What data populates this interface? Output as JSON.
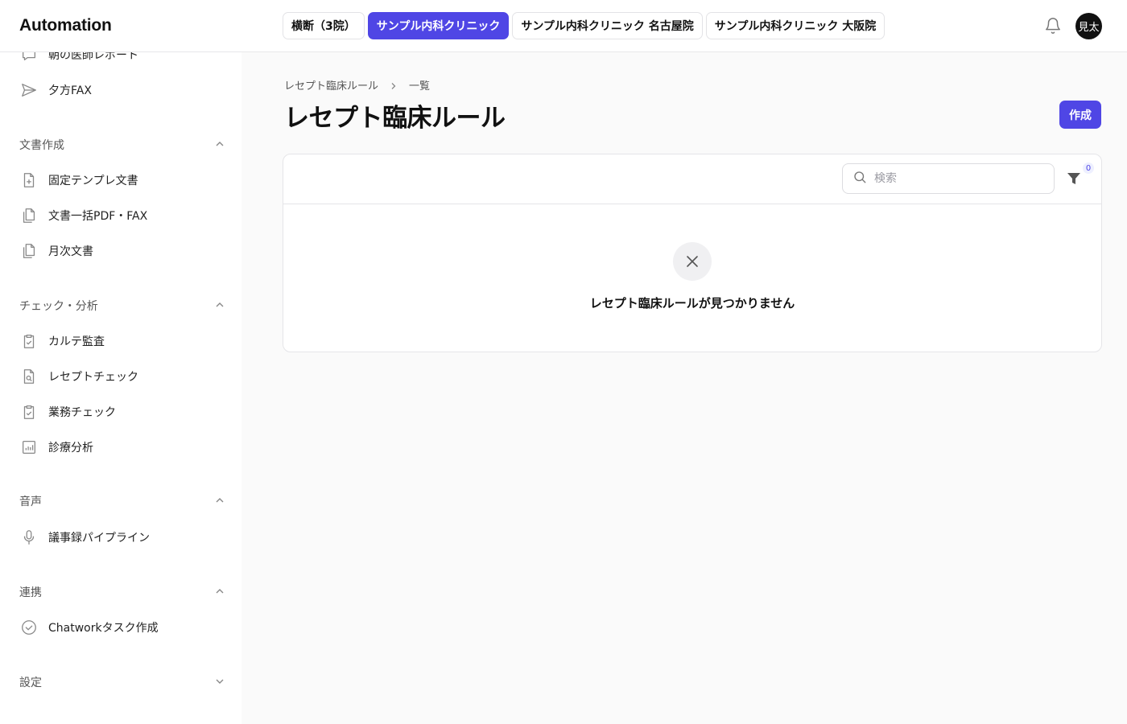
{
  "header": {
    "brand": "Automation",
    "tabs": [
      {
        "label": "横断（3院）",
        "active": false
      },
      {
        "label": "サンプル内科クリニック",
        "active": true
      },
      {
        "label": "サンプル内科クリニック 名古屋院",
        "active": false
      },
      {
        "label": "サンプル内科クリニック 大阪院",
        "active": false
      }
    ],
    "avatar_text": "見太"
  },
  "sidebar": {
    "top_items": [
      {
        "label": "朝の医師レポート",
        "icon": "chat-bubble-icon"
      },
      {
        "label": "夕方FAX",
        "icon": "send-icon"
      }
    ],
    "sections": [
      {
        "label": "文書作成",
        "expanded": true,
        "items": [
          {
            "label": "固定テンプレ文書",
            "icon": "file-plus-icon"
          },
          {
            "label": "文書一括PDF・FAX",
            "icon": "files-icon"
          },
          {
            "label": "月次文書",
            "icon": "files-icon"
          }
        ]
      },
      {
        "label": "チェック・分析",
        "expanded": true,
        "items": [
          {
            "label": "カルテ監査",
            "icon": "clipboard-check-icon"
          },
          {
            "label": "レセプトチェック",
            "icon": "file-search-icon"
          },
          {
            "label": "業務チェック",
            "icon": "clipboard-check-icon"
          },
          {
            "label": "診療分析",
            "icon": "bar-chart-icon"
          }
        ]
      },
      {
        "label": "音声",
        "expanded": true,
        "items": [
          {
            "label": "議事録パイプライン",
            "icon": "microphone-icon"
          }
        ]
      },
      {
        "label": "連携",
        "expanded": true,
        "items": [
          {
            "label": "Chatworkタスク作成",
            "icon": "check-circle-icon"
          }
        ]
      },
      {
        "label": "設定",
        "expanded": false,
        "items": []
      }
    ]
  },
  "main": {
    "breadcrumb": [
      "レセプト臨床ルール",
      "一覧"
    ],
    "title": "レセプト臨床ルール",
    "create_label": "作成",
    "search_placeholder": "検索",
    "filter_count": "0",
    "empty_message": "レセプト臨床ルールが見つかりません"
  },
  "colors": {
    "accent": "#4f46e5",
    "background": "#fafafa"
  }
}
